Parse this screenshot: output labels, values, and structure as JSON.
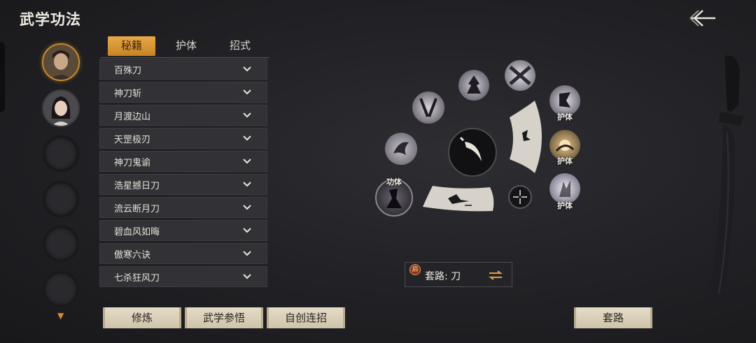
{
  "header": {
    "title": "武学功法",
    "back_icon": "back-arrow-icon"
  },
  "avatars": [
    {
      "name": "male-hero",
      "state": "active"
    },
    {
      "name": "female-hero",
      "state": "normal"
    },
    {
      "name": "empty",
      "state": "empty"
    },
    {
      "name": "empty",
      "state": "empty"
    },
    {
      "name": "empty",
      "state": "empty"
    },
    {
      "name": "empty",
      "state": "empty"
    }
  ],
  "tabs": [
    {
      "label": "秘籍",
      "active": true
    },
    {
      "label": "护体",
      "active": false
    },
    {
      "label": "招式",
      "active": false
    }
  ],
  "list": [
    {
      "label": "百殊刀"
    },
    {
      "label": "神刀斩"
    },
    {
      "label": "月渡边山"
    },
    {
      "label": "天罡极刃"
    },
    {
      "label": "神刀鬼谕"
    },
    {
      "label": "浩星撼日刀"
    },
    {
      "label": "流云断月刀"
    },
    {
      "label": "碧血风如晦"
    },
    {
      "label": "傲寒六诀"
    },
    {
      "label": "七杀狂风刀"
    }
  ],
  "buttons": {
    "practice": "修炼",
    "insight": "武学参悟",
    "custom_combo": "自创连招",
    "suit": "套路"
  },
  "skills": {
    "gongti_label": "功体",
    "huti_labels": [
      "护体",
      "护体",
      "护体"
    ]
  },
  "suit": {
    "badge": "启",
    "label": "套路: 刀"
  },
  "colors": {
    "accent": "#d98a27",
    "tab_active": "#e0a040",
    "button_bg": "#d9d0ba"
  }
}
